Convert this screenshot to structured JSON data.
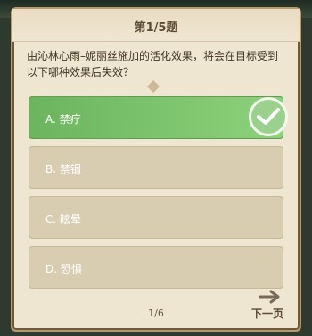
{
  "header": {
    "question_number": "第1/5题"
  },
  "question": {
    "text": "由沁林心雨–妮丽丝施加的活化效果，将会在目标受到以下哪种效果后失效？"
  },
  "options": [
    {
      "label": "A. 禁疗",
      "selected": true
    },
    {
      "label": "B. 禁锢",
      "selected": false
    },
    {
      "label": "C. 眩晕",
      "selected": false
    },
    {
      "label": "D. 恐惧",
      "selected": false
    }
  ],
  "footer": {
    "page_indicator": "1/6",
    "next_label": "下一页"
  },
  "icons": {
    "selected_check": "check-icon",
    "next_arrow": "arrow-right-icon"
  },
  "colors": {
    "selected": "#7cc46c",
    "option_bg": "#d8ccb1",
    "panel_bg": "#efe6d2"
  }
}
